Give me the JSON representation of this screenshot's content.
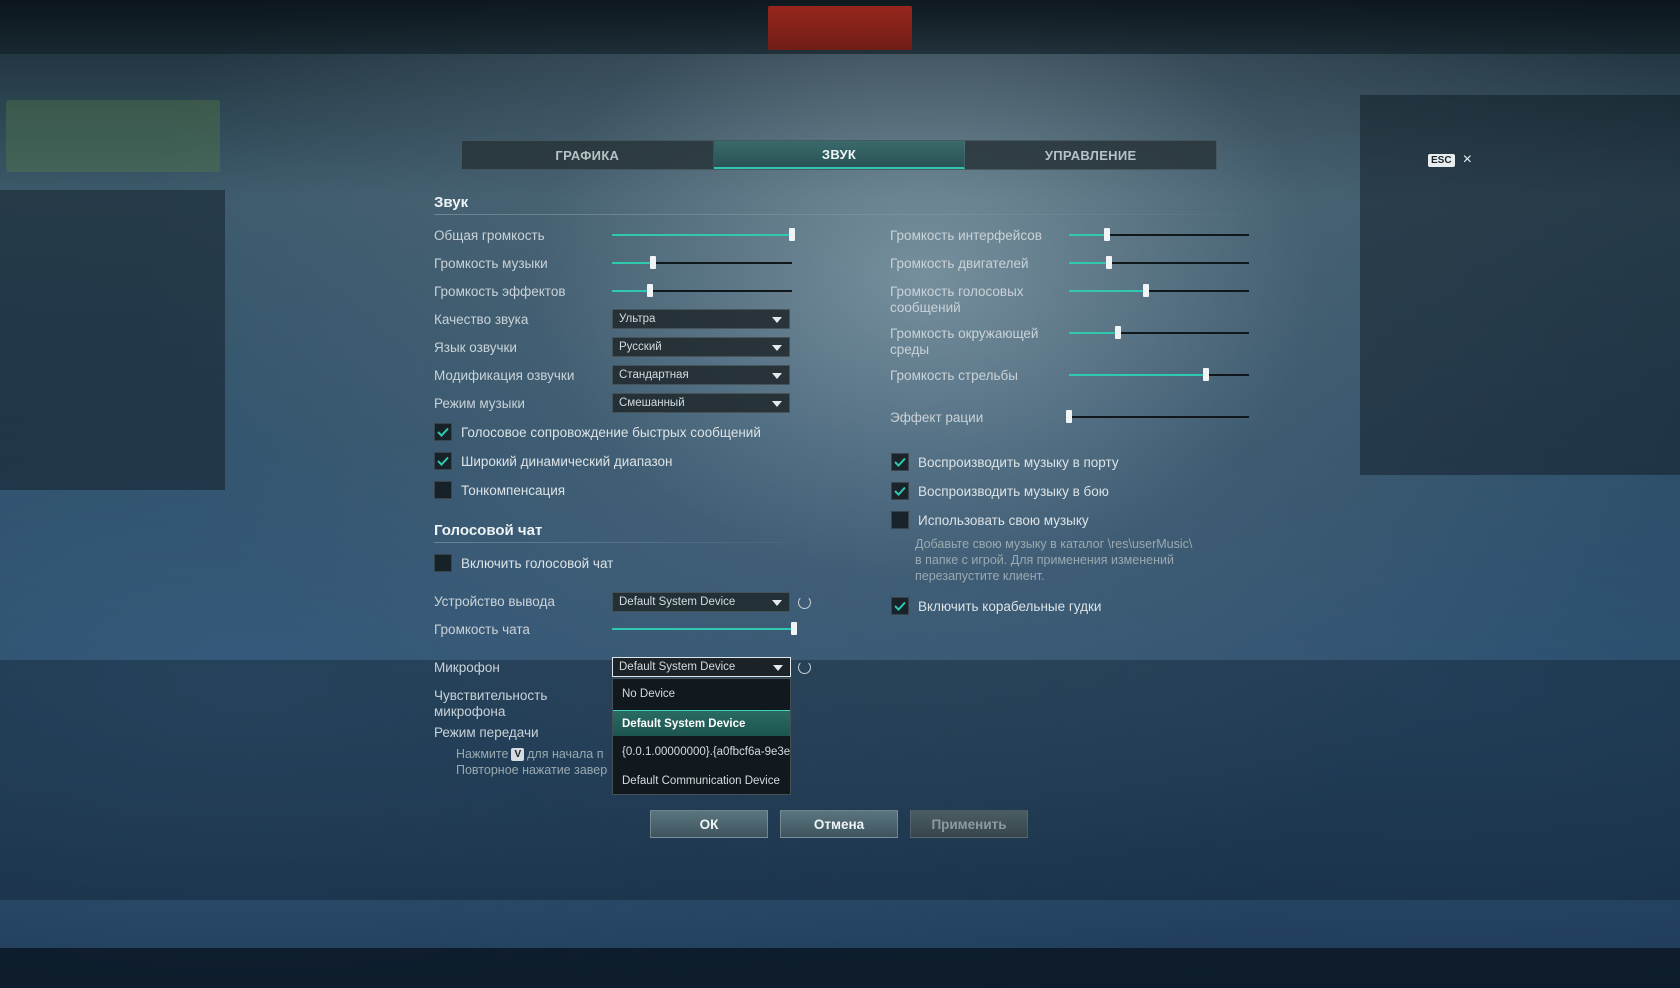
{
  "tabs": [
    {
      "label": "ГРАФИКА"
    },
    {
      "label": "ЗВУК"
    },
    {
      "label": "УПРАВЛЕНИЕ"
    }
  ],
  "esc": {
    "key": "ESC",
    "close": "×"
  },
  "sound": {
    "title": "Звук",
    "left_sliders": [
      {
        "label": "Общая громкость",
        "value": 1.0
      },
      {
        "label": "Громкость музыки",
        "value": 0.23
      },
      {
        "label": "Громкость эффектов",
        "value": 0.21
      }
    ],
    "dropdowns": [
      {
        "label": "Качество звука",
        "value": "Ультра"
      },
      {
        "label": "Язык озвучки",
        "value": "Русский"
      },
      {
        "label": "Модификация озвучки",
        "value": "Стандартная"
      },
      {
        "label": "Режим музыки",
        "value": "Смешанный"
      }
    ],
    "left_checkboxes": [
      {
        "label": "Голосовое сопровождение быстрых сообщений",
        "checked": true
      },
      {
        "label": "Широкий динамический диапазон",
        "checked": true
      },
      {
        "label": "Тонкомпенсация",
        "checked": false
      }
    ],
    "right_sliders": [
      {
        "label": "Громкость интерфейсов",
        "value": 0.21
      },
      {
        "label": "Громкость двигателей",
        "value": 0.22
      },
      {
        "label": "Громкость голосовых сообщений",
        "value": 0.43
      },
      {
        "label": "Громкость окружающей среды",
        "value": 0.27
      },
      {
        "label": "Громкость стрельбы",
        "value": 0.76
      },
      {
        "label": "Эффект рации",
        "value": 0.0
      }
    ],
    "right_checkboxes": [
      {
        "label": "Воспроизводить музыку в порту",
        "checked": true
      },
      {
        "label": "Воспроизводить музыку в бою",
        "checked": true
      },
      {
        "label": "Использовать свою музыку",
        "checked": false
      },
      {
        "label": "Включить корабельные гудки",
        "checked": true
      }
    ],
    "music_hint": [
      "Добавьте свою музыку в каталог \\res\\userMusic\\",
      "в папке с игрой. Для применения изменений",
      "перезапустите клиент."
    ]
  },
  "voice_chat": {
    "title": "Голосовой чат",
    "enable_label": "Включить голосовой чат",
    "enable_checked": false,
    "output_label": "Устройство вывода",
    "output_value": "Default System Device",
    "chat_volume_label": "Громкость чата",
    "chat_volume_value": 1.0,
    "mic_label": "Микрофон",
    "mic_value": "Default System Device",
    "sensitivity_label": "Чувствительность микрофона",
    "transmit_label": "Режим передачи",
    "transmit_hint_1a": "Нажмите",
    "transmit_hint_key": "V",
    "transmit_hint_1b": "для начала п",
    "transmit_hint_2": "Повторное нажатие завер",
    "mic_options": [
      {
        "label": "No Device",
        "selected": false
      },
      {
        "label": "Default System Device",
        "selected": true
      },
      {
        "label": "{0.0.1.00000000}.{a0fbcf6a-9e3e-",
        "selected": false
      },
      {
        "label": "Default Communication Device",
        "selected": false
      }
    ]
  },
  "buttons": {
    "ok": "ОК",
    "cancel": "Отмена",
    "apply": "Применить"
  },
  "colors": {
    "accent": "#2fc9b0",
    "danger": "#b0281c"
  }
}
